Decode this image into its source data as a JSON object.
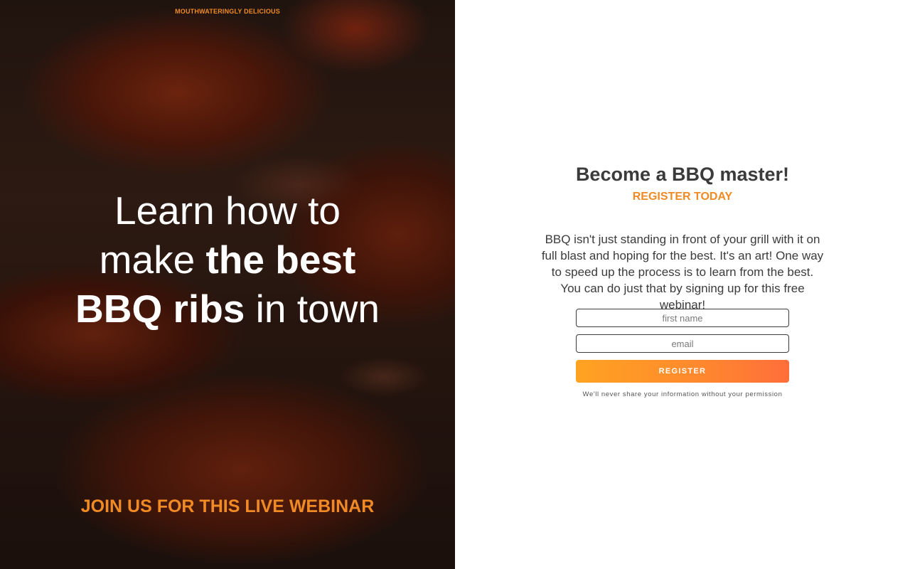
{
  "hero_panel": {
    "tagline": "MOUTHWATERINGLY DELICIOUS",
    "headline": {
      "line1": "Learn how to",
      "line2_regular": "make ",
      "line2_bold": "the best",
      "line3_bold": "BBQ ribs",
      "line3_regular": " in town"
    },
    "cta": "JOIN US FOR THIS LIVE WEBINAR"
  },
  "signup_panel": {
    "heading": "Become a BBQ master!",
    "subheading": "REGISTER TODAY",
    "description": "BBQ isn't just standing in front of your grill with it on full blast and hoping for the best. It's an art! One way to speed up the process is to learn from the best. You can do just that by signing up for this free webinar!",
    "form": {
      "first_name": {
        "value": "",
        "placeholder": "first name"
      },
      "email": {
        "value": "",
        "placeholder": "email"
      },
      "register_label": "REGISTER",
      "privacy_note": "We'll never share your information without your permission"
    }
  },
  "colors": {
    "accent": "#f08a24",
    "text": "#3b3b3b",
    "button_gradient_start": "#ffa321",
    "button_gradient_end": "#ff6e3a"
  }
}
